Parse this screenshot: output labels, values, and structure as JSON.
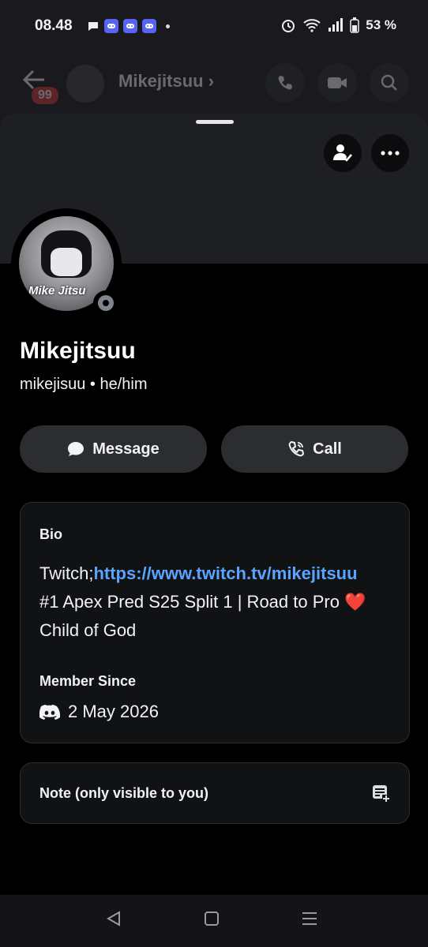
{
  "status_bar": {
    "time": "08.48",
    "battery": "53 %",
    "icons": [
      "chat-bubble-icon",
      "discord-icon",
      "discord-icon",
      "discord-icon",
      "alarm-icon",
      "wifi-icon",
      "signal-icon",
      "battery-icon"
    ]
  },
  "background_header": {
    "back_icon": "back-arrow-icon",
    "unread_badge": "99",
    "name": "Mikejitsuu",
    "buttons": [
      "call-icon",
      "video-icon",
      "search-icon"
    ]
  },
  "profile": {
    "avatar_text": "Mike Jitsu",
    "display_name": "Mikejitsuu",
    "username_line": "mikejisuu • he/him",
    "status": "offline"
  },
  "actions": {
    "message_label": "Message",
    "call_label": "Call"
  },
  "bio": {
    "title": "Bio",
    "line1_prefix": "Twitch;",
    "line1_link": "https://www.twitch.tv/mikejitsuu",
    "line2": "#1 Apex Pred S25 Split 1 | Road to Pro ❤️",
    "line3": "Child of God",
    "member_since_title": "Member Since",
    "member_since_date": "2 May 2026"
  },
  "note": {
    "label": "Note (only visible to you)"
  },
  "colors": {
    "background": "#000000",
    "card": "#111214",
    "button": "#2b2d31",
    "link": "#5aa3ff",
    "discord": "#5865f2"
  }
}
